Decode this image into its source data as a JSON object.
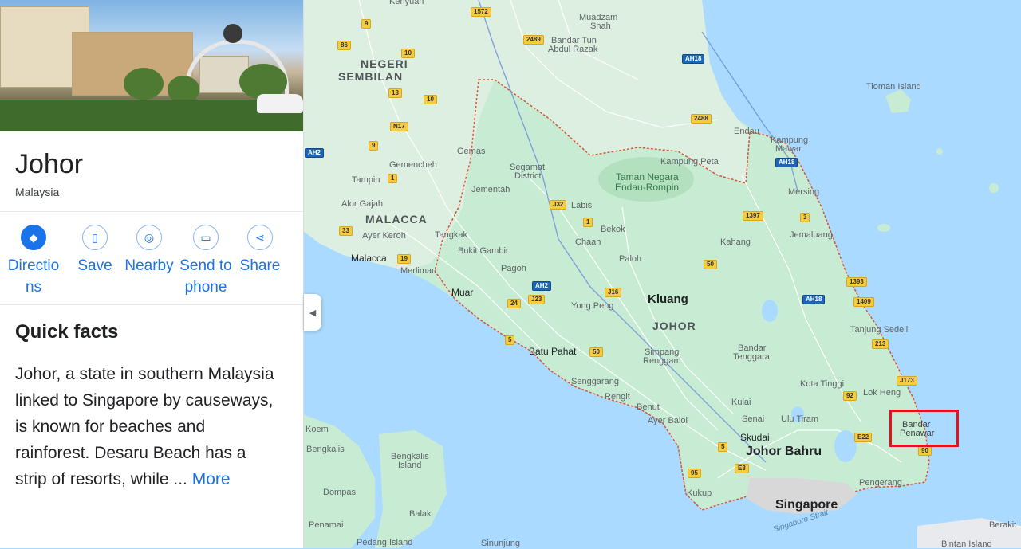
{
  "place": {
    "name": "Johor",
    "country": "Malaysia"
  },
  "actions": [
    {
      "label": "Directions",
      "line1": "Directio",
      "line2": "ns",
      "icon": "directions-icon"
    },
    {
      "label": "Save",
      "icon": "bookmark-icon"
    },
    {
      "label": "Nearby",
      "icon": "nearby-icon"
    },
    {
      "label": "Send to phone",
      "line1": "Send to",
      "line2": "phone",
      "icon": "send-to-phone-icon"
    },
    {
      "label": "Share",
      "icon": "share-icon"
    }
  ],
  "quick_facts": {
    "heading": "Quick facts",
    "text": "Johor, a state in southern Malaysia linked to Singapore by causeways, is known for beaches and rainforest. Desaru Beach has a strip of resorts, while ...",
    "more": "More"
  },
  "colors": {
    "water": "#aadaff",
    "land_other": "#e8eaed",
    "johor_land": "#c8ecd3",
    "park": "#b3e0be",
    "border": "#d5563a",
    "accent": "#1a73e8",
    "highlight": "#e0141e"
  },
  "map": {
    "states": [
      "NEGERI SEMBILAN",
      "MALACCA",
      "JOHOR"
    ],
    "cities": [
      "Kluang",
      "Johor Bahru",
      "Singapore"
    ],
    "towns": [
      "Muar",
      "Batu Pahat",
      "Skudai",
      "Malacca"
    ],
    "places": [
      "Kenyuan",
      "Muadzam Shah",
      "Bandar Tun Abdul Razak",
      "Tioman Island",
      "Endau",
      "Kampung Mawar",
      "Kampung Peta",
      "Taman Negara Endau-Rompin",
      "Segamat District",
      "Gemas",
      "Gemencheh",
      "Tampin",
      "Jementah",
      "Alor Gajah",
      "Labis",
      "Bekok",
      "Chaah",
      "Mersing",
      "Jemaluang",
      "Kahang",
      "Ayer Keroh",
      "Tangkak",
      "Bukit Gambir",
      "Merlimau",
      "Pagoh",
      "Paloh",
      "Yong Peng",
      "Simpang Renggam",
      "Bandar Tenggara",
      "Tanjung Sedeli",
      "Kota Tinggi",
      "Lok Heng",
      "Senggarang",
      "Rengit",
      "Benut",
      "Ayer Baloi",
      "Kulai",
      "Senai",
      "Ulu Tiram",
      "Bandar Penawar",
      "Pengerang",
      "Kukup",
      "Bengkalis",
      "Bengkalis Island",
      "Dompas",
      "Balak",
      "Penamai",
      "Pedang Island",
      "Sinunjung",
      "Berakit",
      "Bintan Island",
      "Koem"
    ],
    "water": [
      "Singapore Strait"
    ],
    "roads": [
      "1572",
      "2489",
      "9",
      "86",
      "10",
      "13",
      "10",
      "N17",
      "9",
      "1",
      "33",
      "19",
      "AH2",
      "J32",
      "1",
      "J16",
      "24",
      "J23",
      "5",
      "50",
      "2488",
      "1397",
      "3",
      "50",
      "1393",
      "1409",
      "213",
      "J173",
      "92",
      "E22",
      "5",
      "E3",
      "95",
      "90",
      "AH18",
      "AH18",
      "AH18",
      "AH2"
    ],
    "highlighted_place": "Bandar Penawar"
  }
}
